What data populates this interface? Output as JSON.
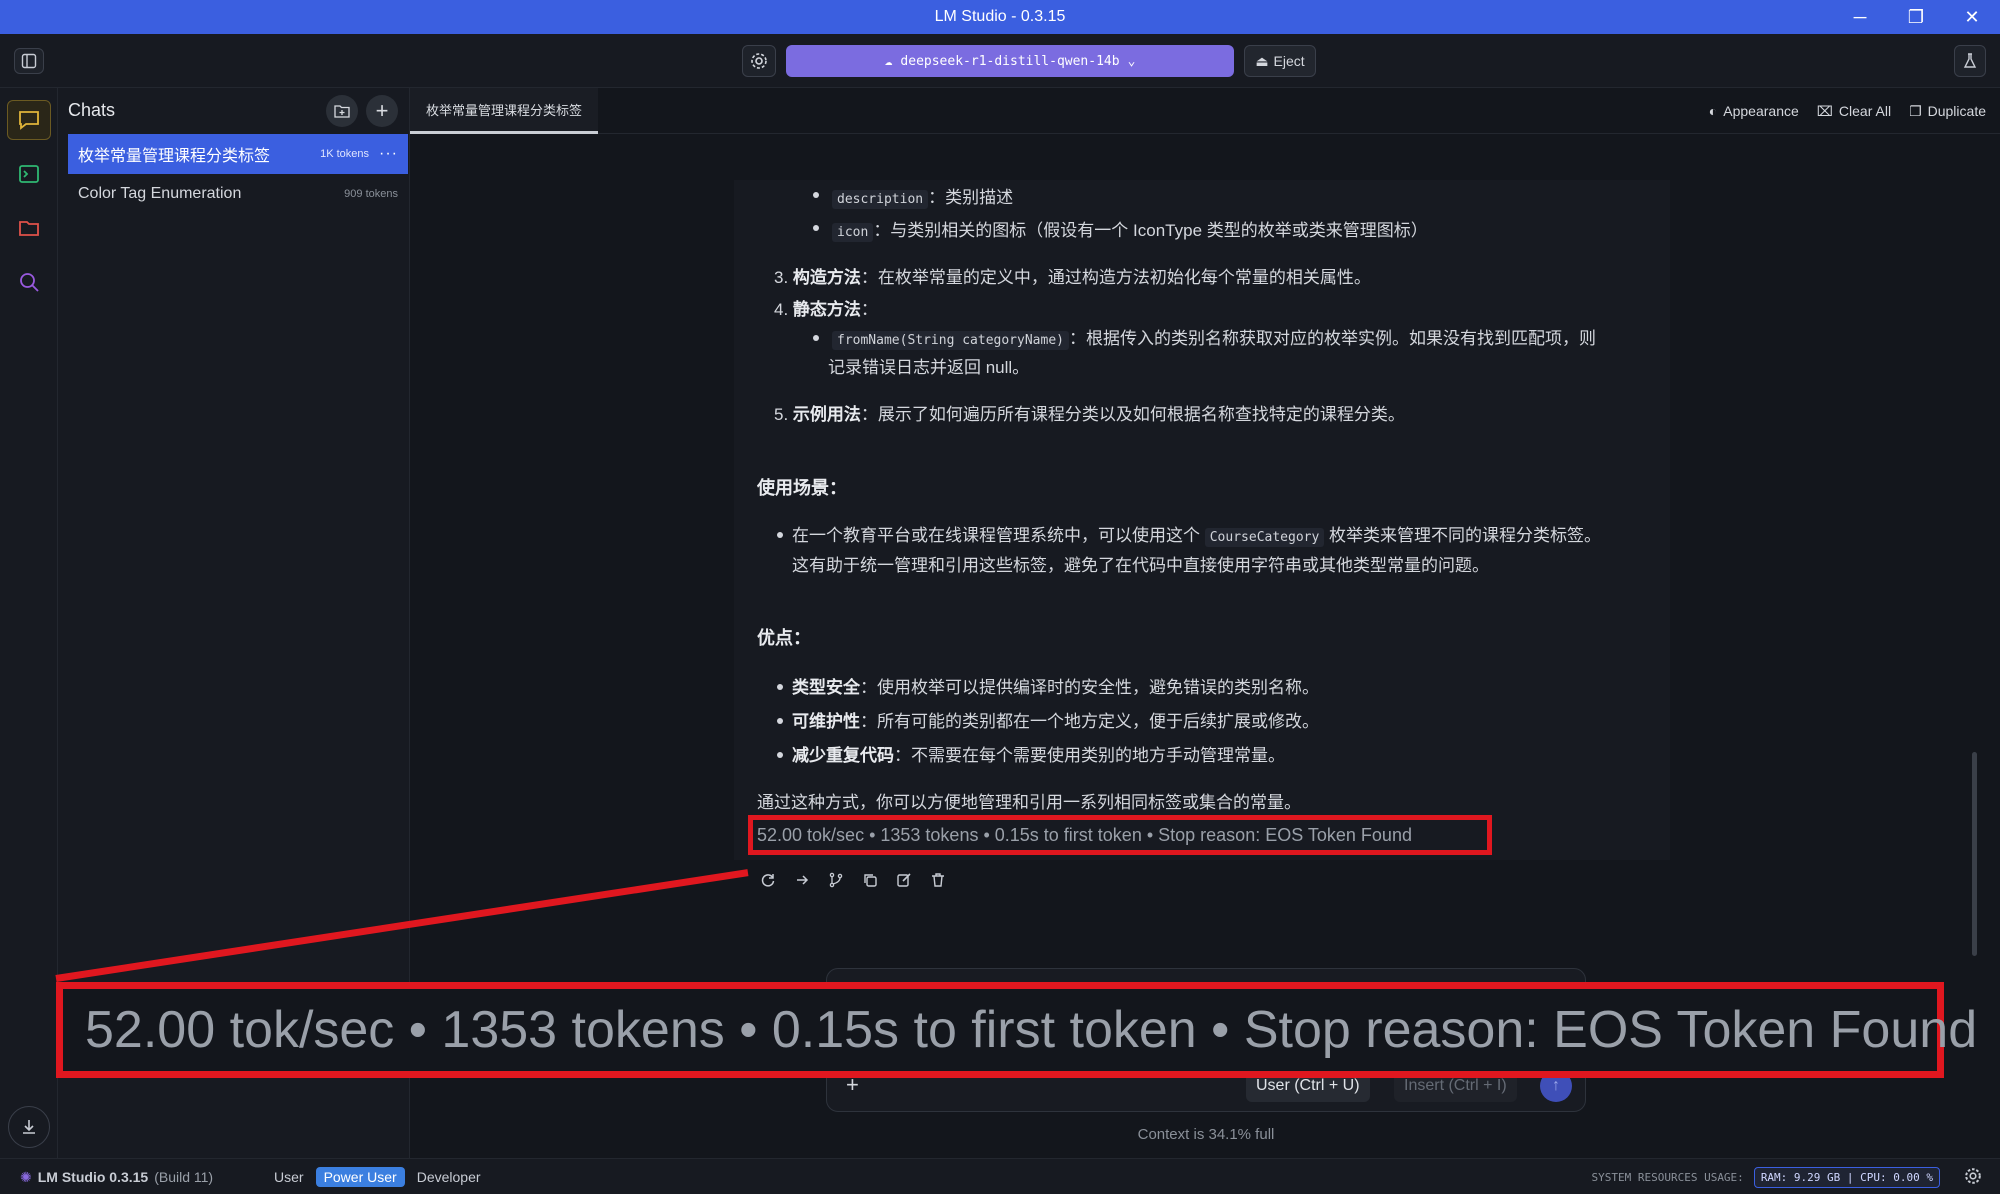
{
  "window": {
    "title": "LM Studio - 0.3.15",
    "controls": [
      "─",
      "❐",
      "✕"
    ]
  },
  "toolbar": {
    "model_name": "deepseek-r1-distill-qwen-14b",
    "eject_label": "Eject"
  },
  "chats": {
    "title": "Chats",
    "items": [
      {
        "name": "枚举常量管理课程分类标签",
        "tokens": "1K tokens",
        "active": true
      },
      {
        "name": "Color Tag Enumeration",
        "tokens": "909 tokens",
        "active": false
      }
    ]
  },
  "tab": {
    "label": "枚举常量管理课程分类标签"
  },
  "tab_actions": {
    "appearance": "Appearance",
    "clear_all": "Clear All",
    "duplicate": "Duplicate"
  },
  "message": {
    "item_description_code": "description",
    "item_description_text": "：类别描述",
    "item_icon_code": "icon",
    "item_icon_text": "：与类别相关的图标（假设有一个 IconType 类型的枚举或类来管理图标）",
    "n3": "3.",
    "s3_bold": "构造方法",
    "s3_text": "：在枚举常量的定义中，通过构造方法初始化每个常量的相关属性。",
    "n4": "4.",
    "s4_bold": "静态方法",
    "s4_text": "：",
    "s4_code": "fromName(String categoryName)",
    "s4_item_text1": "：根据传入的类别名称获取对应的枚举实例。如果没有找到匹配项，则",
    "s4_item_text2": "记录错误日志并返回 null。",
    "n5": "5.",
    "s5_bold": "示例用法",
    "s5_text": "：展示了如何遍历所有课程分类以及如何根据名称查找特定的课程分类。",
    "usage_heading": "使用场景：",
    "usage_text1a": "在一个教育平台或在线课程管理系统中，可以使用这个",
    "usage_code": "CourseCategory",
    "usage_text1b": "枚举类来管理不同的课程分类标签。",
    "usage_text2": "这有助于统一管理和引用这些标签，避免了在代码中直接使用字符串或其他类型常量的问题。",
    "adv_heading": "优点：",
    "adv1_bold": "类型安全",
    "adv1_text": "：使用枚举可以提供编译时的安全性，避免错误的类别名称。",
    "adv2_bold": "可维护性",
    "adv2_text": "：所有可能的类别都在一个地方定义，便于后续扩展或修改。",
    "adv3_bold": "减少重复代码",
    "adv3_text": "：不需要在每个需要使用类别的地方手动管理常量。",
    "closing": "通过这种方式，你可以方便地管理和引用一系列相同标签或集合的常量。",
    "stats": "52.00 tok/sec • 1353 tokens • 0.15s to first token • Stop reason: EOS Token Found"
  },
  "zoom_callout": {
    "text": "52.00 tok/sec • 1353 tokens • 0.15s to first token • Stop reason: EOS Token Found"
  },
  "input": {
    "role_label": "User (Ctrl + U)",
    "insert_label": "Insert (Ctrl + I)",
    "context_text": "Context is 34.1% full"
  },
  "statusbar": {
    "app_name": "LM Studio 0.3.15",
    "build": "(Build 11)",
    "modes": [
      "User",
      "Power User",
      "Developer"
    ],
    "active_mode": "Power User",
    "sysres_label": "SYSTEM RESOURCES USAGE:",
    "sysres_value": "RAM: 9.29 GB | CPU: 0.00 %"
  },
  "colors": {
    "accent": "#3b5fe0",
    "model_pill": "#7b6ce0",
    "highlight": "#e0171f",
    "rail_active": "#e0b43a"
  }
}
